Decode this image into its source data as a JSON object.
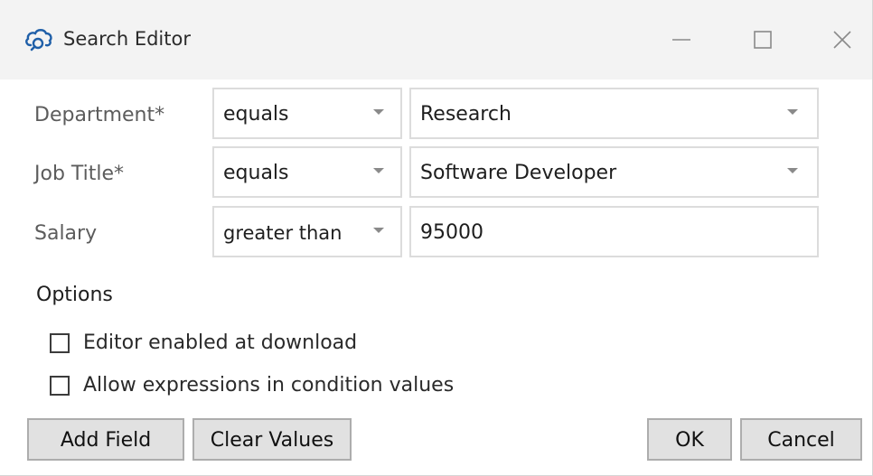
{
  "window": {
    "title": "Search Editor",
    "icon": "cloud-search-icon",
    "controls": [
      "minimize-icon",
      "maximize-icon",
      "close-icon"
    ]
  },
  "conditions": [
    {
      "label": "Department*",
      "operator": "equals",
      "value": "Research",
      "value_is_dropdown": true
    },
    {
      "label": "Job Title*",
      "operator": "equals",
      "value": "Software Developer",
      "value_is_dropdown": true
    },
    {
      "label": "Salary",
      "operator": "greater than",
      "value": "95000",
      "value_is_dropdown": false
    }
  ],
  "options": {
    "title": "Options",
    "items": [
      {
        "label": "Editor enabled at download",
        "checked": false
      },
      {
        "label": "Allow expressions in condition values",
        "checked": false
      }
    ]
  },
  "buttons": {
    "add_field": "Add Field",
    "clear_values": "Clear Values",
    "ok": "OK",
    "cancel": "Cancel"
  },
  "colors": {
    "titlebar": "#f3f3f3",
    "icon_blue": "#1f5fa8",
    "field_border": "#dcdcdc",
    "button_bg": "#e1e1e1",
    "button_border": "#adadad"
  }
}
